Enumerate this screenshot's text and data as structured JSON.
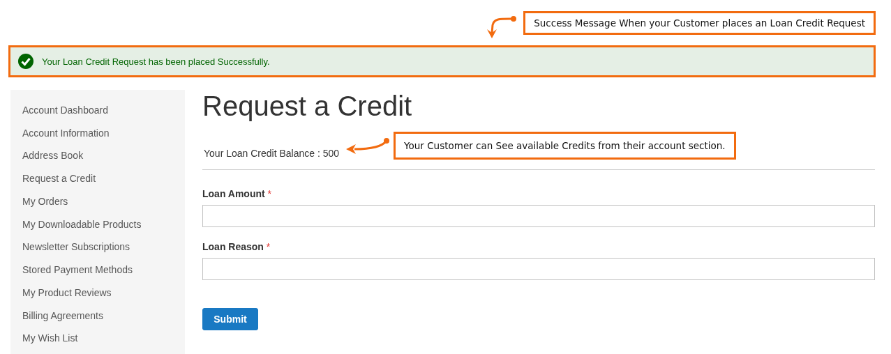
{
  "annotations": [
    {
      "text": "Success Message When your Customer places an Loan Credit Request"
    },
    {
      "text": "Your Customer can See available Credits from their account section."
    }
  ],
  "message": {
    "kind": "success",
    "text": "Your Loan Credit Request has been placed Successfully."
  },
  "sidebar": {
    "items": [
      "Account Dashboard",
      "Account Information",
      "Address Book",
      "Request a Credit",
      "My Orders",
      "My Downloadable Products",
      "Newsletter Subscriptions",
      "Stored Payment Methods",
      "My Product Reviews",
      "Billing Agreements",
      "My Wish List"
    ]
  },
  "page_title": "Request a Credit",
  "balance": "Your Loan Credit Balance : 500",
  "fields": [
    {
      "label": "Loan Amount",
      "required_mark": "*"
    },
    {
      "label": "Loan Reason",
      "required_mark": "*"
    }
  ],
  "submit": "Submit"
}
